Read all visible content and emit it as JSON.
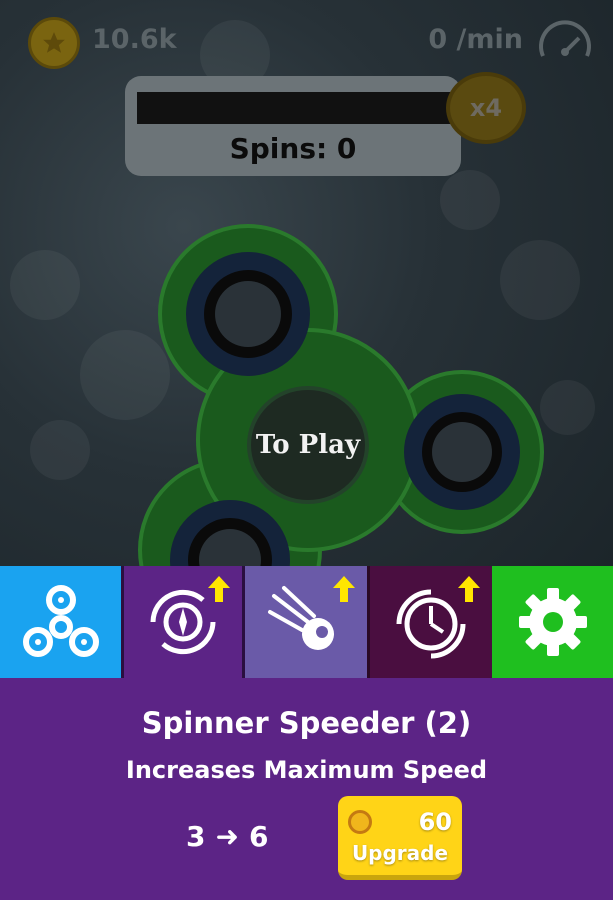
{
  "hud": {
    "coins": "10.6k",
    "rate": "0 /min",
    "coin_icon": "star-coin-icon",
    "speed_icon": "speedometer-icon"
  },
  "spins": {
    "label": "Spins: 0",
    "multiplier": "x4"
  },
  "spinner": {
    "center_label": "To Play",
    "color": "#1f6b22"
  },
  "tabs": [
    {
      "name": "spinner",
      "icon": "fidget-spinner-icon",
      "color": "#1aa3f0",
      "has_upgrade": false
    },
    {
      "name": "spinner-speeder",
      "icon": "vortex-compass-icon",
      "color": "#5c2486",
      "has_upgrade": true
    },
    {
      "name": "comet",
      "icon": "comet-icon",
      "color": "#6a5aa8",
      "has_upgrade": true
    },
    {
      "name": "clock-speed",
      "icon": "clock-gauge-icon",
      "color": "#4a0e40",
      "has_upgrade": true
    },
    {
      "name": "settings",
      "icon": "gear-icon",
      "color": "#1fbf1f",
      "has_upgrade": false
    }
  ],
  "upgrade": {
    "title": "Spinner Speeder (2)",
    "description": "Increases Maximum Speed",
    "from_value": "3",
    "to_value": "6",
    "cost": "60",
    "button_label": "Upgrade"
  }
}
